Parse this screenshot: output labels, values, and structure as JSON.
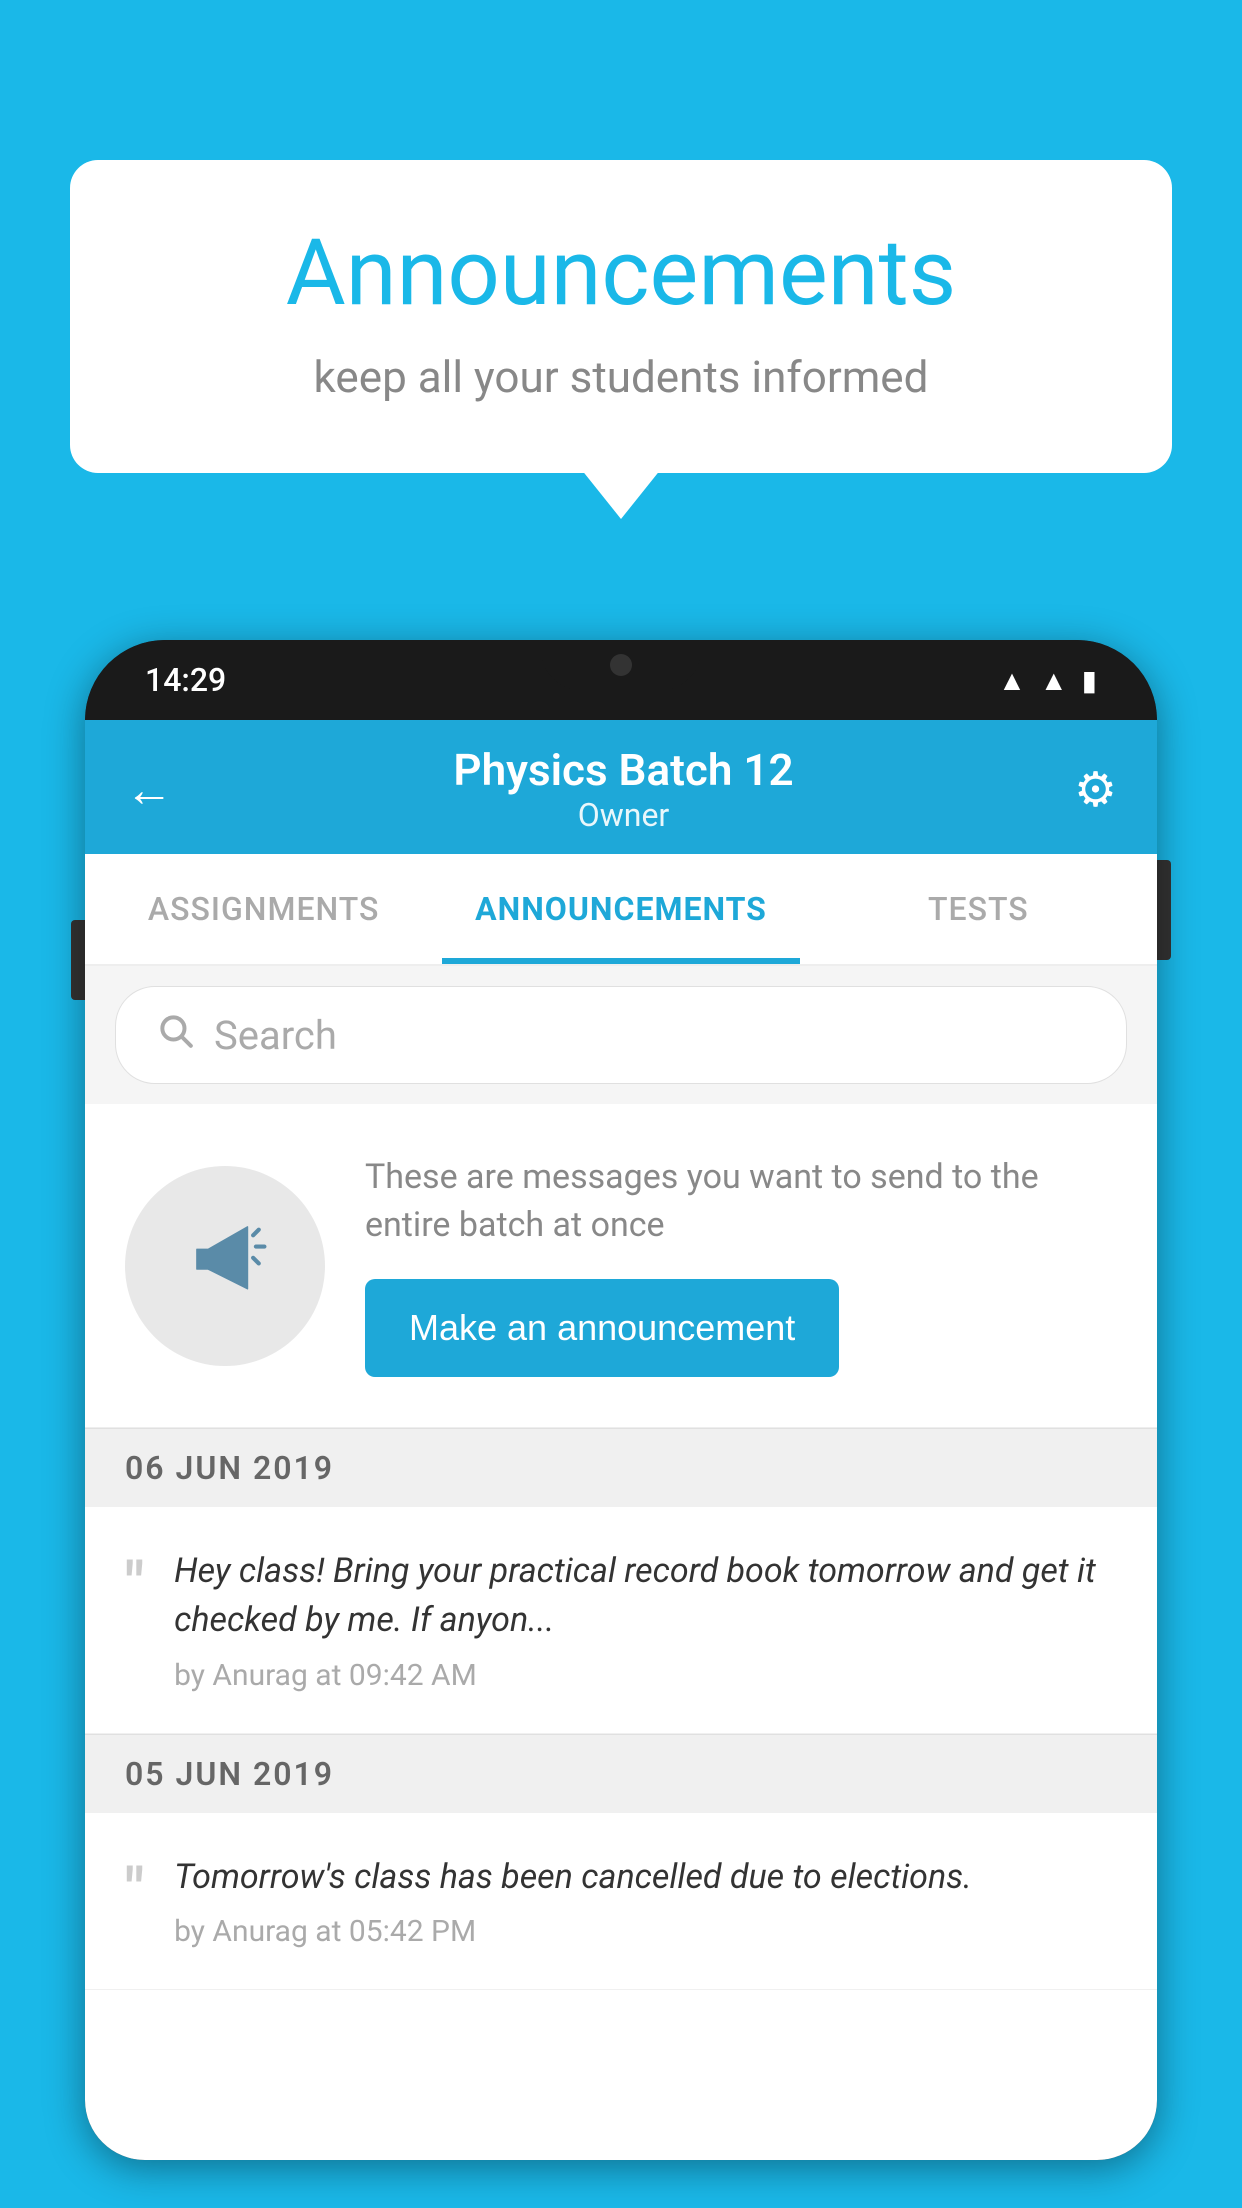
{
  "page": {
    "background_color": "#1ab8e8"
  },
  "speech_bubble": {
    "title": "Announcements",
    "subtitle": "keep all your students informed"
  },
  "phone": {
    "status_bar": {
      "time": "14:29"
    },
    "header": {
      "title": "Physics Batch 12",
      "subtitle": "Owner",
      "back_label": "←",
      "gear_label": "⚙"
    },
    "tabs": [
      {
        "label": "ASSIGNMENTS",
        "active": false
      },
      {
        "label": "ANNOUNCEMENTS",
        "active": true
      },
      {
        "label": "TESTS",
        "active": false
      },
      {
        "label": "···",
        "active": false
      }
    ],
    "search": {
      "placeholder": "Search"
    },
    "announcement_prompt": {
      "description": "These are messages you want to send to the entire batch at once",
      "button_label": "Make an announcement"
    },
    "announcements": [
      {
        "date": "06  JUN  2019",
        "text": "Hey class! Bring your practical record book tomorrow and get it checked by me. If anyon...",
        "meta": "by Anurag at 09:42 AM"
      },
      {
        "date": "05  JUN  2019",
        "text": "Tomorrow's class has been cancelled due to elections.",
        "meta": "by Anurag at 05:42 PM"
      }
    ]
  }
}
